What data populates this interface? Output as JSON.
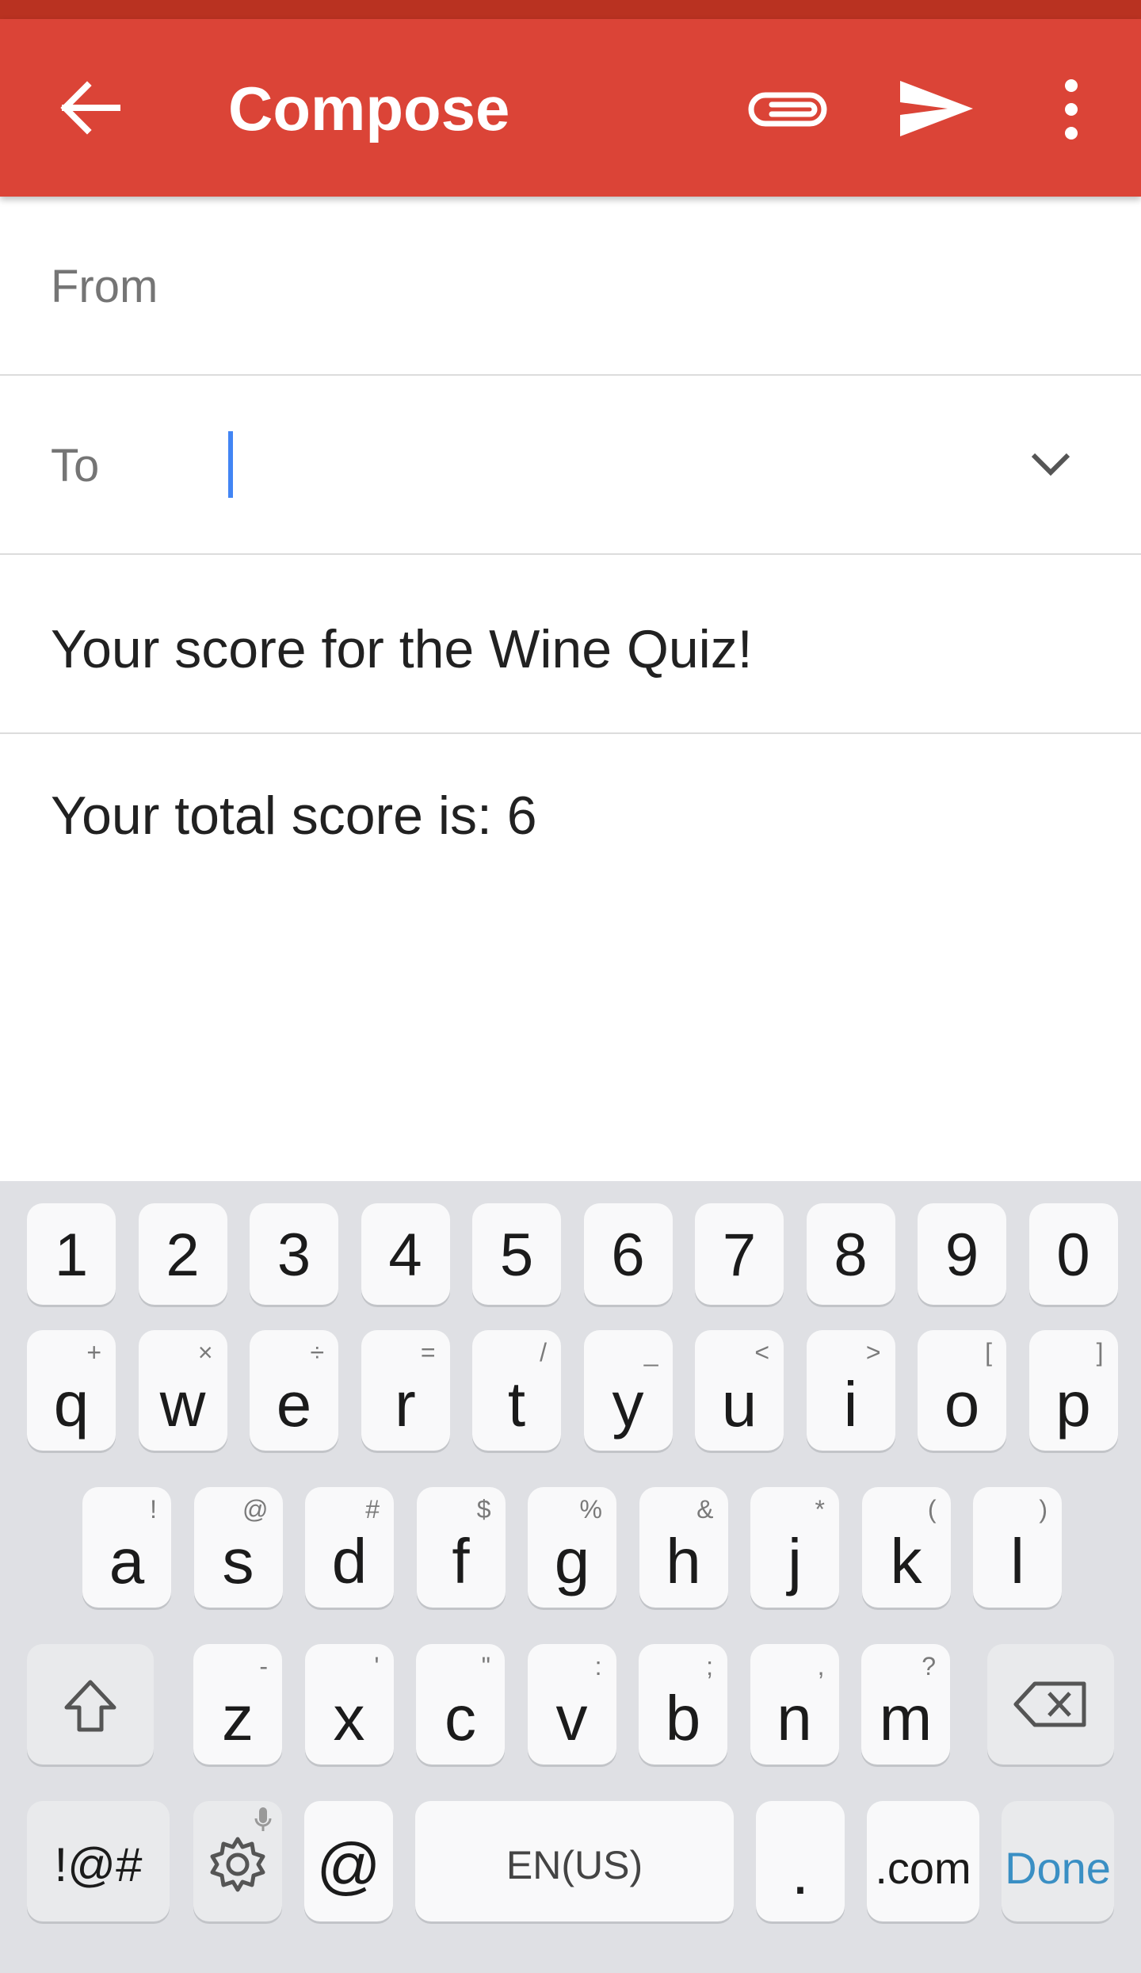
{
  "app_bar": {
    "title": "Compose",
    "icons": [
      "back-arrow-icon",
      "attachment-icon",
      "send-icon",
      "more-vert-icon"
    ],
    "color": "#db4437"
  },
  "form": {
    "from_label": "From",
    "to_label": "To",
    "to_value": "",
    "subject": "Your score for the Wine Quiz!",
    "body": "Your total score is: 6"
  },
  "keyboard": {
    "number_row": [
      "1",
      "2",
      "3",
      "4",
      "5",
      "6",
      "7",
      "8",
      "9",
      "0"
    ],
    "row1": [
      {
        "k": "q",
        "h": "+"
      },
      {
        "k": "w",
        "h": "×"
      },
      {
        "k": "e",
        "h": "÷"
      },
      {
        "k": "r",
        "h": "="
      },
      {
        "k": "t",
        "h": "/"
      },
      {
        "k": "y",
        "h": "_"
      },
      {
        "k": "u",
        "h": "<"
      },
      {
        "k": "i",
        "h": ">"
      },
      {
        "k": "o",
        "h": "["
      },
      {
        "k": "p",
        "h": "]"
      }
    ],
    "row2": [
      {
        "k": "a",
        "h": "!"
      },
      {
        "k": "s",
        "h": "@"
      },
      {
        "k": "d",
        "h": "#"
      },
      {
        "k": "f",
        "h": "$"
      },
      {
        "k": "g",
        "h": "%"
      },
      {
        "k": "h",
        "h": "&"
      },
      {
        "k": "j",
        "h": "*"
      },
      {
        "k": "k",
        "h": "("
      },
      {
        "k": "l",
        "h": ")"
      }
    ],
    "row3": [
      {
        "k": "z",
        "h": "-"
      },
      {
        "k": "x",
        "h": "'"
      },
      {
        "k": "c",
        "h": "\""
      },
      {
        "k": "v",
        "h": ":"
      },
      {
        "k": "b",
        "h": ";"
      },
      {
        "k": "n",
        "h": ","
      },
      {
        "k": "m",
        "h": "?"
      }
    ],
    "symbols_label": "!@#",
    "at_label": "@",
    "space_label": "EN(US)",
    "period_label": ".",
    "dotcom_label": ".com",
    "done_label": "Done",
    "done_color": "#3a8fc4"
  }
}
